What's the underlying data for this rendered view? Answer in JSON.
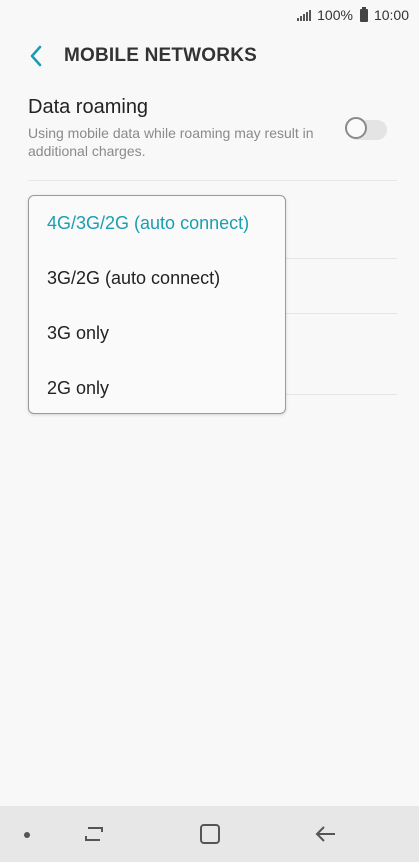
{
  "status_bar": {
    "battery": "100%",
    "time": "10:00",
    "signal_icon": "signal-icon",
    "battery_icon": "battery-icon"
  },
  "header": {
    "title": "MOBILE NETWORKS",
    "back_icon": "chevron-left-icon",
    "accent_color": "#1a9fb0"
  },
  "settings": {
    "data_roaming": {
      "title": "Data roaming",
      "subtitle": "Using mobile data while roaming may result in additional charges.",
      "enabled": false
    }
  },
  "network_mode_dropdown": {
    "selected_index": 0,
    "options": [
      "4G/3G/2G (auto connect)",
      "3G/2G (auto connect)",
      "3G only",
      "2G only"
    ]
  },
  "nav_bar": {
    "icons": [
      "dot-icon",
      "recent-apps-icon",
      "home-icon",
      "back-arrow-icon"
    ]
  }
}
